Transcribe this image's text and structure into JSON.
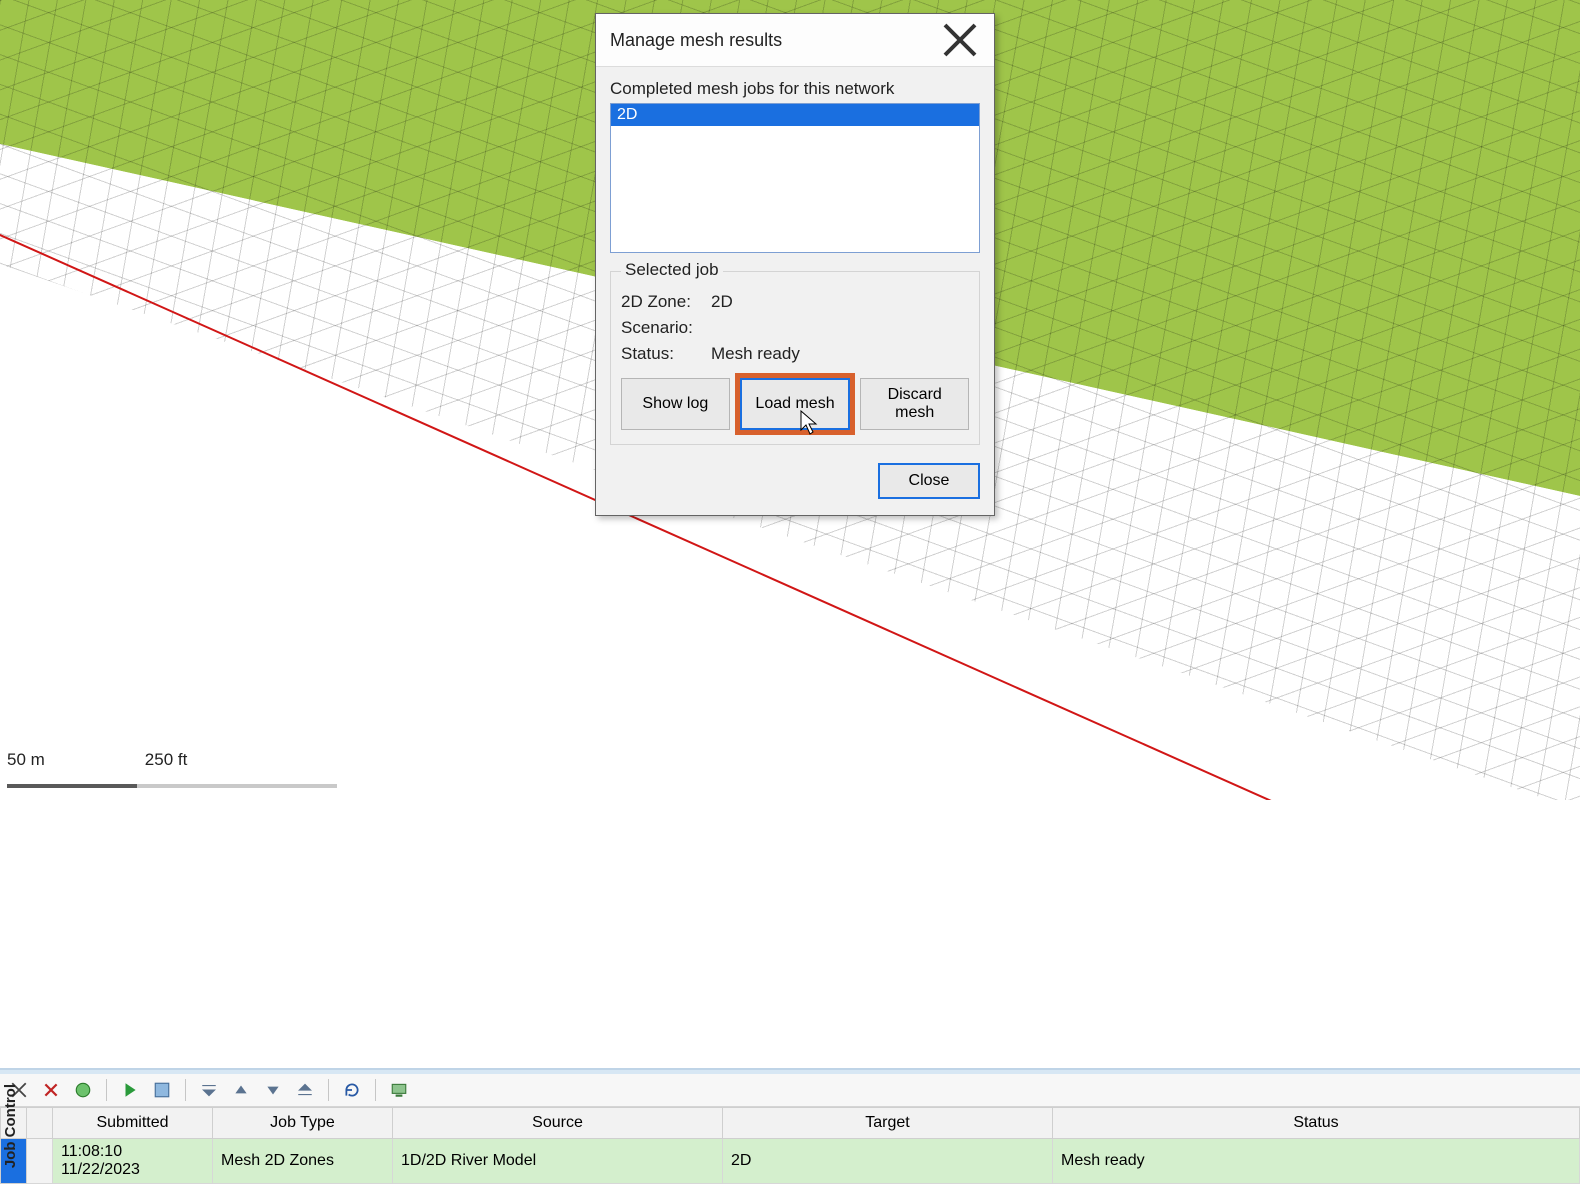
{
  "dialog": {
    "title": "Manage mesh results",
    "jobs_label": "Completed mesh jobs for this network",
    "jobs": [
      "2D"
    ],
    "group_title": "Selected job",
    "zone_label": "2D Zone:",
    "zone_value": "2D",
    "scenario_label": "Scenario:",
    "scenario_value": "",
    "status_label": "Status:",
    "status_value": "Mesh ready",
    "btn_show_log": "Show log",
    "btn_load_mesh": "Load mesh",
    "btn_discard_mesh": "Discard mesh",
    "btn_close": "Close"
  },
  "scale": {
    "label_a": "50 m",
    "label_b": "250 ft"
  },
  "panel": {
    "side_label": "Job Control",
    "columns": [
      "Submitted",
      "Job Type",
      "Source",
      "Target",
      "Status"
    ],
    "rows": [
      {
        "submitted": "11:08:10 11/22/2023",
        "job_type": "Mesh 2D Zones",
        "source": "1D/2D River Model",
        "target": "2D",
        "status": "Mesh ready"
      }
    ]
  },
  "colors": {
    "accent_blue": "#1a6fe0",
    "mesh_green": "#9fc54a",
    "highlight_orange": "#d8612d",
    "row_green": "#d4efcd",
    "boundary_red": "#d11616"
  }
}
